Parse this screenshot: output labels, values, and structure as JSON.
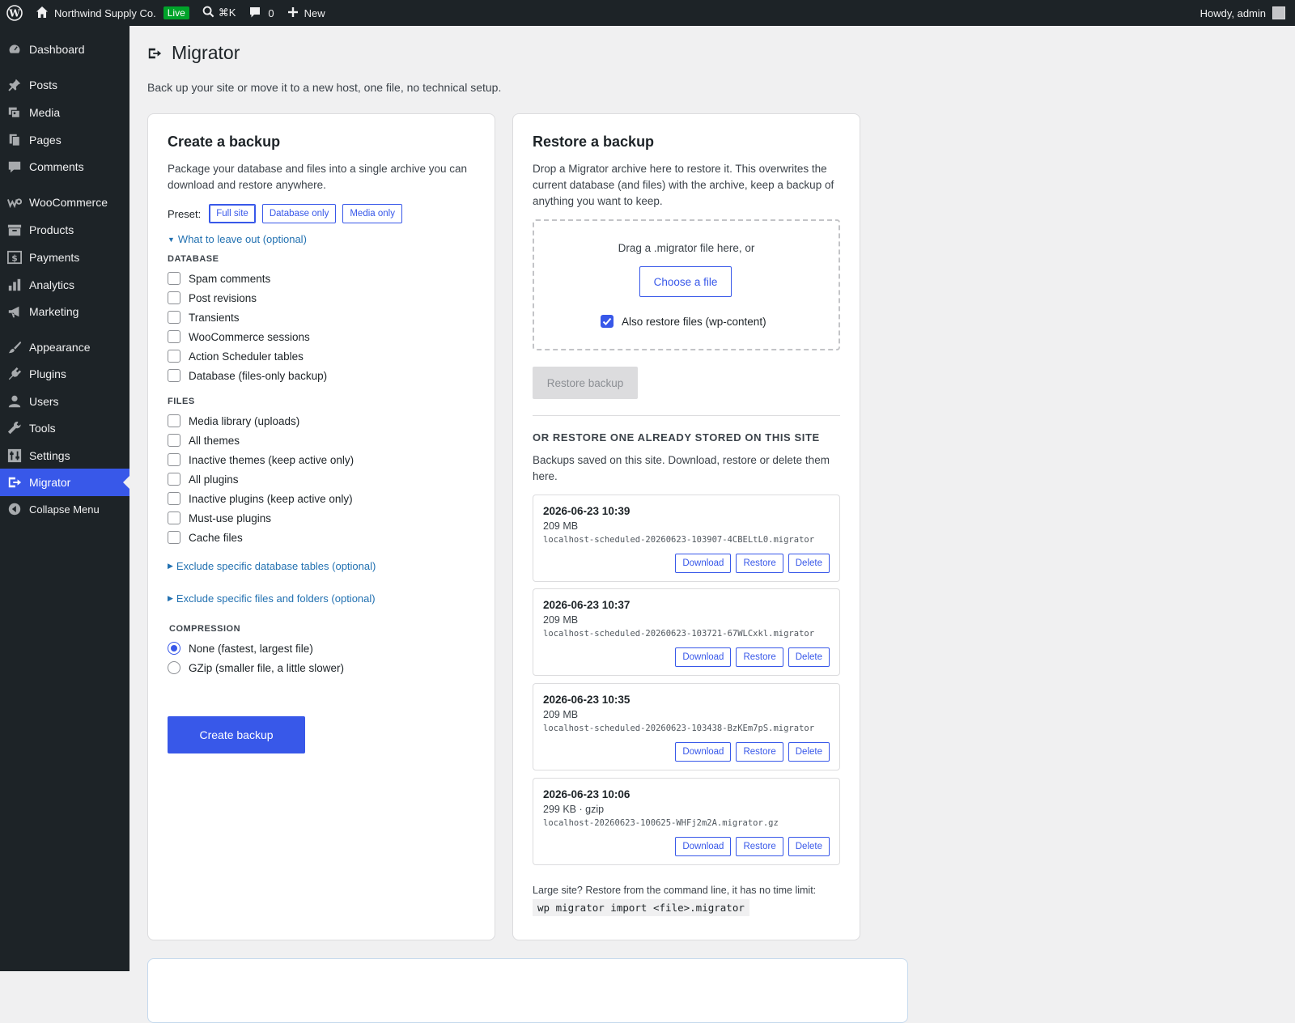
{
  "adminbar": {
    "site_name": "Northwind Supply Co.",
    "live_badge": "Live",
    "search_shortcut": "⌘K",
    "comments_count": "0",
    "new_label": "New",
    "howdy": "Howdy, admin"
  },
  "sidebar": {
    "items": [
      {
        "label": "Dashboard",
        "icon": "dashboard-icon"
      },
      {
        "label": "Posts",
        "icon": "pin-icon"
      },
      {
        "label": "Media",
        "icon": "media-icon"
      },
      {
        "label": "Pages",
        "icon": "pages-icon"
      },
      {
        "label": "Comments",
        "icon": "comment-icon"
      },
      {
        "label": "WooCommerce",
        "icon": "woo-icon"
      },
      {
        "label": "Products",
        "icon": "archive-icon"
      },
      {
        "label": "Payments",
        "icon": "dollar-icon"
      },
      {
        "label": "Analytics",
        "icon": "bar-chart-icon"
      },
      {
        "label": "Marketing",
        "icon": "megaphone-icon"
      },
      {
        "label": "Appearance",
        "icon": "brush-icon"
      },
      {
        "label": "Plugins",
        "icon": "plug-icon"
      },
      {
        "label": "Users",
        "icon": "user-icon"
      },
      {
        "label": "Tools",
        "icon": "wrench-icon"
      },
      {
        "label": "Settings",
        "icon": "sliders-icon"
      },
      {
        "label": "Migrator",
        "icon": "migrate-icon"
      },
      {
        "label": "Collapse Menu",
        "icon": "collapse-icon"
      }
    ]
  },
  "page": {
    "title": "Migrator",
    "subtitle": "Back up your site or move it to a new host, one file, no technical setup."
  },
  "create": {
    "title": "Create a backup",
    "desc_line1": "Package your database and files into a single archive you can",
    "desc_line2": "download and restore anywhere.",
    "preset_label": "Preset:",
    "presets": [
      "Full site",
      "Database only",
      "Media only"
    ],
    "leave_out_toggle": "What to leave out (optional)",
    "database_head": "DATABASE",
    "database_options": [
      "Spam comments",
      "Post revisions",
      "Transients",
      "WooCommerce sessions",
      "Action Scheduler tables",
      "Database (files-only backup)"
    ],
    "files_head": "FILES",
    "files_options": [
      "Media library (uploads)",
      "All themes",
      "Inactive themes (keep active only)",
      "All plugins",
      "Inactive plugins (keep active only)",
      "Must-use plugins",
      "Cache files"
    ],
    "exclude_tables": "Exclude specific database tables (optional)",
    "exclude_files": "Exclude specific files and folders (optional)",
    "compression_head": "COMPRESSION",
    "compression_options": [
      "None (fastest, largest file)",
      "GZip (smaller file, a little slower)"
    ],
    "compression_selected": 0,
    "button": "Create backup"
  },
  "restore": {
    "title": "Restore a backup",
    "desc_line1": "Drop a Migrator archive here to restore it. This overwrites the",
    "desc_line2": "current database (and files) with the archive, keep a backup of",
    "desc_line3": "anything you want to keep.",
    "drop_text": "Drag a .migrator file here, or",
    "choose_button": "Choose a file",
    "also_restore_label": "Also restore files (wp-content)",
    "also_restore_checked": true,
    "restore_button": "Restore backup",
    "stored_head": "OR RESTORE ONE ALREADY STORED ON THIS SITE",
    "stored_desc_line1": "Backups saved on this site. Download, restore or delete them",
    "stored_desc_line2": "here.",
    "actions": [
      "Download",
      "Restore",
      "Delete"
    ],
    "backups": [
      {
        "date": "2026-06-23 10:39",
        "size": "209 MB",
        "file": "localhost-scheduled-20260623-103907-4CBELtL0.migrator"
      },
      {
        "date": "2026-06-23 10:37",
        "size": "209 MB",
        "file": "localhost-scheduled-20260623-103721-67WLCxkl.migrator"
      },
      {
        "date": "2026-06-23 10:35",
        "size": "209 MB",
        "file": "localhost-scheduled-20260623-103438-BzKEm7pS.migrator"
      },
      {
        "date": "2026-06-23 10:06",
        "size": "299 KB · gzip",
        "file": "localhost-20260623-100625-WHFj2m2A.migrator.gz"
      }
    ],
    "cli_note": "Large site? Restore from the command line, it has no time limit:",
    "cli_code": "wp migrator import <file>.migrator"
  },
  "colors": {
    "accent": "#3858e9",
    "adminbar_bg": "#1d2327",
    "live_badge": "#00a32a"
  }
}
